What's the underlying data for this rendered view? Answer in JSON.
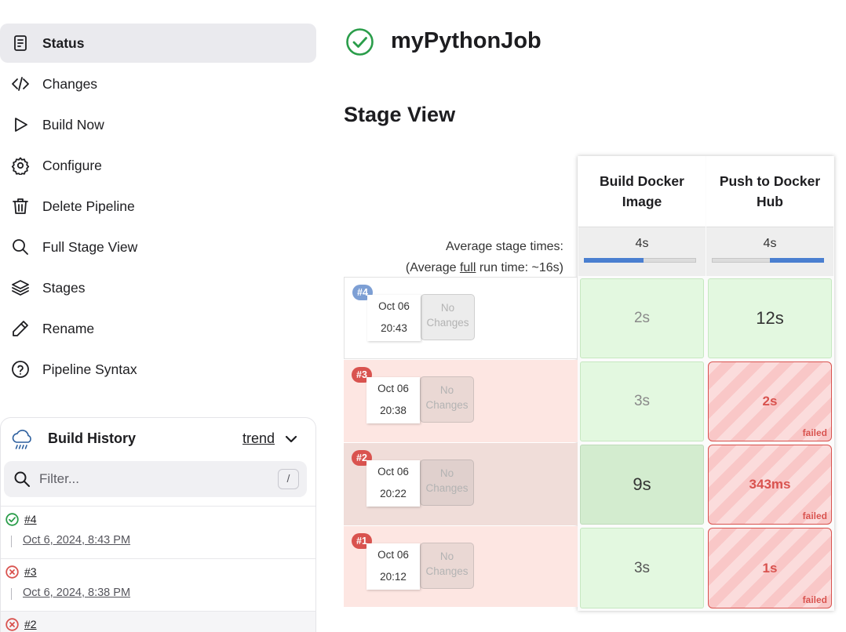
{
  "sidebar": {
    "tasks": [
      {
        "label": "Status",
        "icon": "document-icon",
        "active": true
      },
      {
        "label": "Changes",
        "icon": "code-icon"
      },
      {
        "label": "Build Now",
        "icon": "play-icon"
      },
      {
        "label": "Configure",
        "icon": "gear-icon"
      },
      {
        "label": "Delete Pipeline",
        "icon": "trash-icon"
      },
      {
        "label": "Full Stage View",
        "icon": "search-icon"
      },
      {
        "label": "Stages",
        "icon": "layers-icon"
      },
      {
        "label": "Rename",
        "icon": "pencil-icon"
      },
      {
        "label": "Pipeline Syntax",
        "icon": "help-icon"
      }
    ],
    "build_history": {
      "title": "Build History",
      "trend": "trend",
      "filter_placeholder": "Filter...",
      "shortcut": "/",
      "builds": [
        {
          "number": "#4",
          "date": "Oct 6, 2024, 8:43 PM",
          "status": "success"
        },
        {
          "number": "#3",
          "date": "Oct 6, 2024, 8:38 PM",
          "status": "failed"
        },
        {
          "number": "#2",
          "date": "",
          "status": "failed"
        }
      ]
    }
  },
  "job": {
    "title": "myPythonJob",
    "status": "success"
  },
  "stage_view": {
    "title": "Stage View",
    "avg_label_line1": "Average stage times:",
    "avg_label_pre": "(Average ",
    "avg_label_link": "full",
    "avg_label_post": " run time: ~16s)",
    "stages": [
      {
        "name": "Build Docker Image",
        "avg": "4s",
        "bar_start": 0.0,
        "bar_fraction": 0.53
      },
      {
        "name": "Push to Docker Hub",
        "avg": "4s",
        "bar_start": 0.52,
        "bar_fraction": 0.48
      }
    ],
    "runs": [
      {
        "badge": "#4",
        "date": "Oct 06",
        "time": "20:43",
        "changes": "No Changes",
        "status": "success",
        "cells": [
          {
            "dur": "2s",
            "status": "success"
          },
          {
            "dur": "12s",
            "status": "success"
          }
        ]
      },
      {
        "badge": "#3",
        "date": "Oct 06",
        "time": "20:38",
        "changes": "No Changes",
        "status": "failed",
        "cells": [
          {
            "dur": "3s",
            "status": "success"
          },
          {
            "dur": "2s",
            "status": "failed",
            "tag": "failed"
          }
        ]
      },
      {
        "badge": "#2",
        "date": "Oct 06",
        "time": "20:22",
        "changes": "No Changes",
        "status": "failed",
        "cells": [
          {
            "dur": "9s",
            "status": "success"
          },
          {
            "dur": "343ms",
            "status": "failed",
            "tag": "failed"
          }
        ]
      },
      {
        "badge": "#1",
        "date": "Oct 06",
        "time": "20:12",
        "changes": "No Changes",
        "status": "failed",
        "cells": [
          {
            "dur": "3s",
            "status": "success"
          },
          {
            "dur": "1s",
            "status": "failed",
            "tag": "failed"
          }
        ]
      }
    ]
  },
  "colors": {
    "success": "#2a9d4a",
    "failed": "#d9534f",
    "badge_success": "#7d9fd4",
    "badge_failed": "#d9534f",
    "row_failed": "#fde6e2",
    "row_failed_hover": "#f0ddd9",
    "cell_success": "#e3f8e0",
    "accent_blue": "#4a7fd0"
  }
}
